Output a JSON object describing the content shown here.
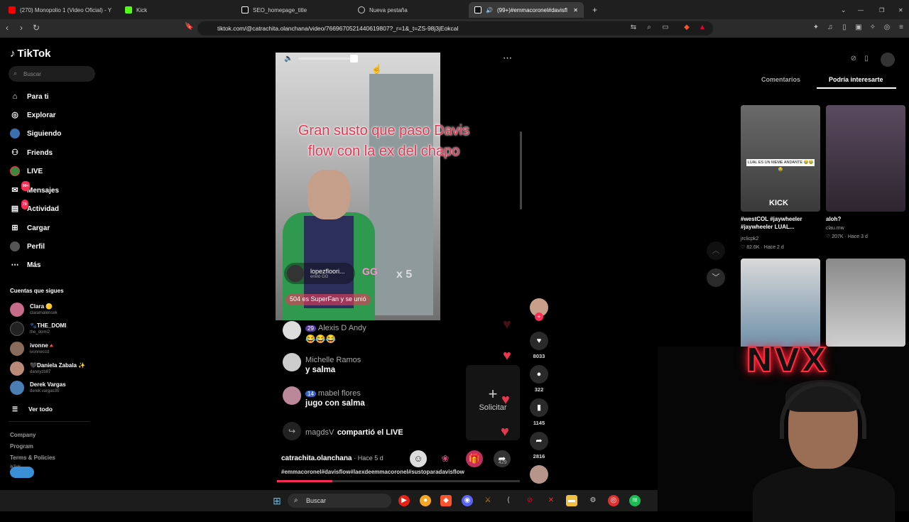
{
  "browser": {
    "tabs": [
      {
        "label": "(270) Monopolio 1 (Video Oficial) - Y",
        "icon": "youtube-icon",
        "color": "#ff0000"
      },
      {
        "label": "Kick",
        "icon": "kick-icon",
        "color": "#53fc18"
      },
      {
        "label": "SEO_homepage_title",
        "icon": "tiktok-icon",
        "color": "#ffffff"
      },
      {
        "label": "Nueva pestaña",
        "icon": "shield-icon",
        "color": "#cccccc"
      },
      {
        "label": "(99+)#emmacoronel#davisfl",
        "icon": "tiktok-icon",
        "color": "#ffffff"
      }
    ],
    "url": "tiktok.com/@catrachita.olanchana/video/7669670521440619807?_r=1&_t=ZS-98j3jEokcal"
  },
  "sidebar": {
    "logo": "TikTok",
    "search_placeholder": "Buscar",
    "nav": [
      {
        "label": "Para ti",
        "icon": "home-icon"
      },
      {
        "label": "Explorar",
        "icon": "compass-icon"
      },
      {
        "label": "Siguiendo",
        "icon": "following-icon"
      },
      {
        "label": "Friends",
        "icon": "friends-icon"
      },
      {
        "label": "LIVE",
        "icon": "live-icon"
      },
      {
        "label": "Mensajes",
        "icon": "messages-icon",
        "badge": "99+"
      },
      {
        "label": "Actividad",
        "icon": "activity-icon",
        "badge": "70"
      },
      {
        "label": "Cargar",
        "icon": "upload-icon"
      },
      {
        "label": "Perfil",
        "icon": "profile-icon"
      },
      {
        "label": "Más",
        "icon": "more-icon"
      }
    ],
    "following_title": "Cuentas que sigues",
    "following": [
      {
        "name": "Clara 🟡",
        "handle": "claramalensek",
        "color": "#c76b8a"
      },
      {
        "name": "🐾THE_DOMI",
        "handle": "the_domi2",
        "color": "#222222"
      },
      {
        "name": "ivonne🔺",
        "handle": "ivonneccd",
        "color": "#8a6a5a"
      },
      {
        "name": "🖤Daniela Zabala ✨",
        "handle": "dannyzb87",
        "color": "#b98a7a"
      },
      {
        "name": "Derek Vargas",
        "handle": "derek.vargas35",
        "color": "#4a7fb5"
      }
    ],
    "see_all": "Ver todo",
    "footer": [
      "Company",
      "Program",
      "Terms & Policies"
    ],
    "footer_copyright": "ikTok"
  },
  "video": {
    "caption": "Gran susto que paso Davis flow con la ex del chapo",
    "gift_user": "lopezfloori...",
    "gift_sub": "envió GG",
    "gift_count": "x 5",
    "superfan_text": "504 es SuperFan y se unió"
  },
  "chat": [
    {
      "level": "29",
      "name": "Alexis D Andy",
      "text": "😂😂😂"
    },
    {
      "level": "",
      "name": "Michelle Ramos",
      "text": "y salma"
    },
    {
      "level": "14",
      "name": "mabel flores",
      "text": "jugo con salma"
    },
    {
      "level": "",
      "name": "magdsV",
      "text": "compartió el LIVE"
    }
  ],
  "request_label": "Solicitar",
  "author": {
    "name": "catrachita.olanchana",
    "time": "· Hace 5 d"
  },
  "hashtags": "#emmacoronel#davisflow#laexdeemmacoronel#sustoparadavisflow",
  "live_viewers": "429",
  "actions": {
    "likes": "8033",
    "comments": "322",
    "saves": "1145",
    "shares": "2816"
  },
  "right_panel": {
    "tabs": [
      "Comentarios",
      "Podría interesarte"
    ],
    "thumb_overlay_text": "LUAL ES UN MEME ANDANTE 😂😂😂",
    "thumb_kick_text": "KICK",
    "items": [
      {
        "title": "#westCOL #jaywheeler #jaywheeler LUAL...",
        "author": "jrclicpk2",
        "likes": "82.6K",
        "time": "Hace 2 d"
      },
      {
        "title": "aloh?",
        "author": "clau.mw",
        "likes": "207K",
        "time": "Hace 3 d"
      }
    ]
  },
  "overlay": {
    "brand": "NVX"
  },
  "taskbar": {
    "search": "Buscar"
  }
}
